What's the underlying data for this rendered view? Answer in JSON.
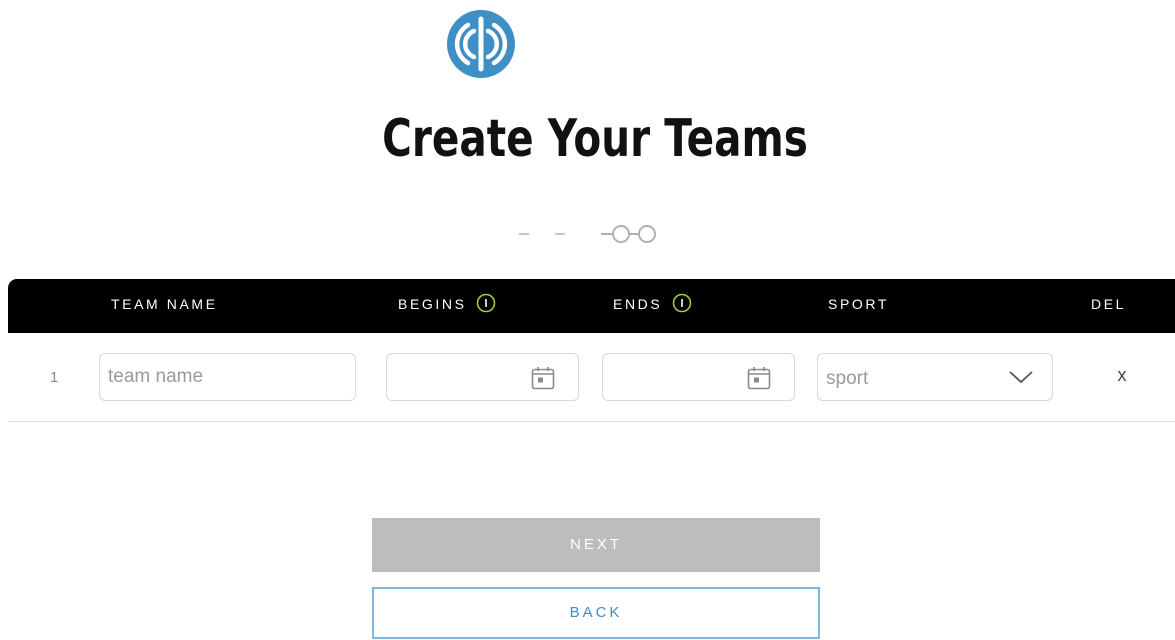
{
  "title": "Create Your Teams",
  "table": {
    "columns": {
      "team_name": "TEAM NAME",
      "begins": "BEGINS",
      "ends": "ENDS",
      "sport": "SPORT",
      "del": "DEL"
    },
    "rows": [
      {
        "number": "1",
        "team_name_placeholder": "team name",
        "team_name_value": "",
        "begins_value": "",
        "ends_value": "",
        "sport_placeholder": "sport",
        "delete_label": "x"
      }
    ]
  },
  "buttons": {
    "next": "NEXT",
    "back": "BACK"
  },
  "progress": {
    "total_steps": 4,
    "current_step": 3
  },
  "icons": {
    "logo": "brand-logo-icon",
    "info": "info-icon",
    "calendar": "calendar-icon",
    "dropdown": "chevron-down-icon"
  },
  "colors": {
    "brand_blue": "#3e8fc6",
    "info_green": "#9ccc3c",
    "header_bg": "#000000",
    "next_disabled": "#bdbdbd"
  }
}
